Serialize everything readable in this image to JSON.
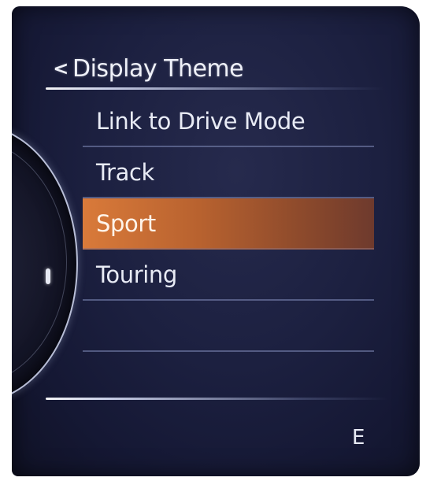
{
  "header": {
    "title": "Display Theme",
    "back_icon": "<"
  },
  "menu": {
    "items": [
      {
        "label": "Link to Drive Mode",
        "selected": false
      },
      {
        "label": "Track",
        "selected": false
      },
      {
        "label": "Sport",
        "selected": true
      },
      {
        "label": "Touring",
        "selected": false
      },
      {
        "label": "",
        "selected": false
      },
      {
        "label": "",
        "selected": false
      }
    ]
  },
  "status": {
    "gear": "E"
  },
  "colors": {
    "background": "#1c2040",
    "highlight": "#d97a3a",
    "text": "#e8ebf5"
  },
  "icons": {
    "back": "chevron-left-icon"
  }
}
